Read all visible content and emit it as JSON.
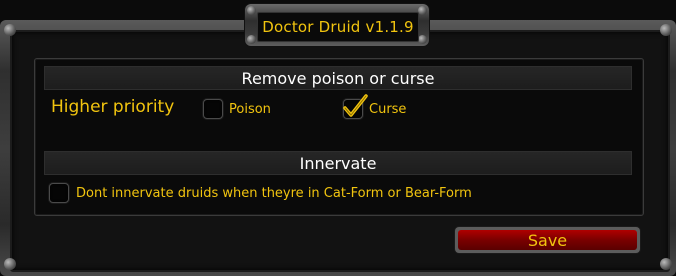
{
  "window": {
    "title": "Doctor Druid v1.1.9"
  },
  "sections": [
    {
      "header": "Remove poison or curse",
      "row_label": "Higher priority",
      "options": [
        {
          "label": "Poison",
          "checked": false
        },
        {
          "label": "Curse",
          "checked": true
        }
      ]
    },
    {
      "header": "Innervate",
      "options": [
        {
          "label": "Dont innervate druids when theyre in Cat-Form or Bear-Form",
          "checked": false
        }
      ]
    }
  ],
  "actions": {
    "save_label": "Save"
  },
  "colors": {
    "label_gold": "#f1c40f",
    "header_text": "#ffffff",
    "button_red": "#b00000"
  }
}
